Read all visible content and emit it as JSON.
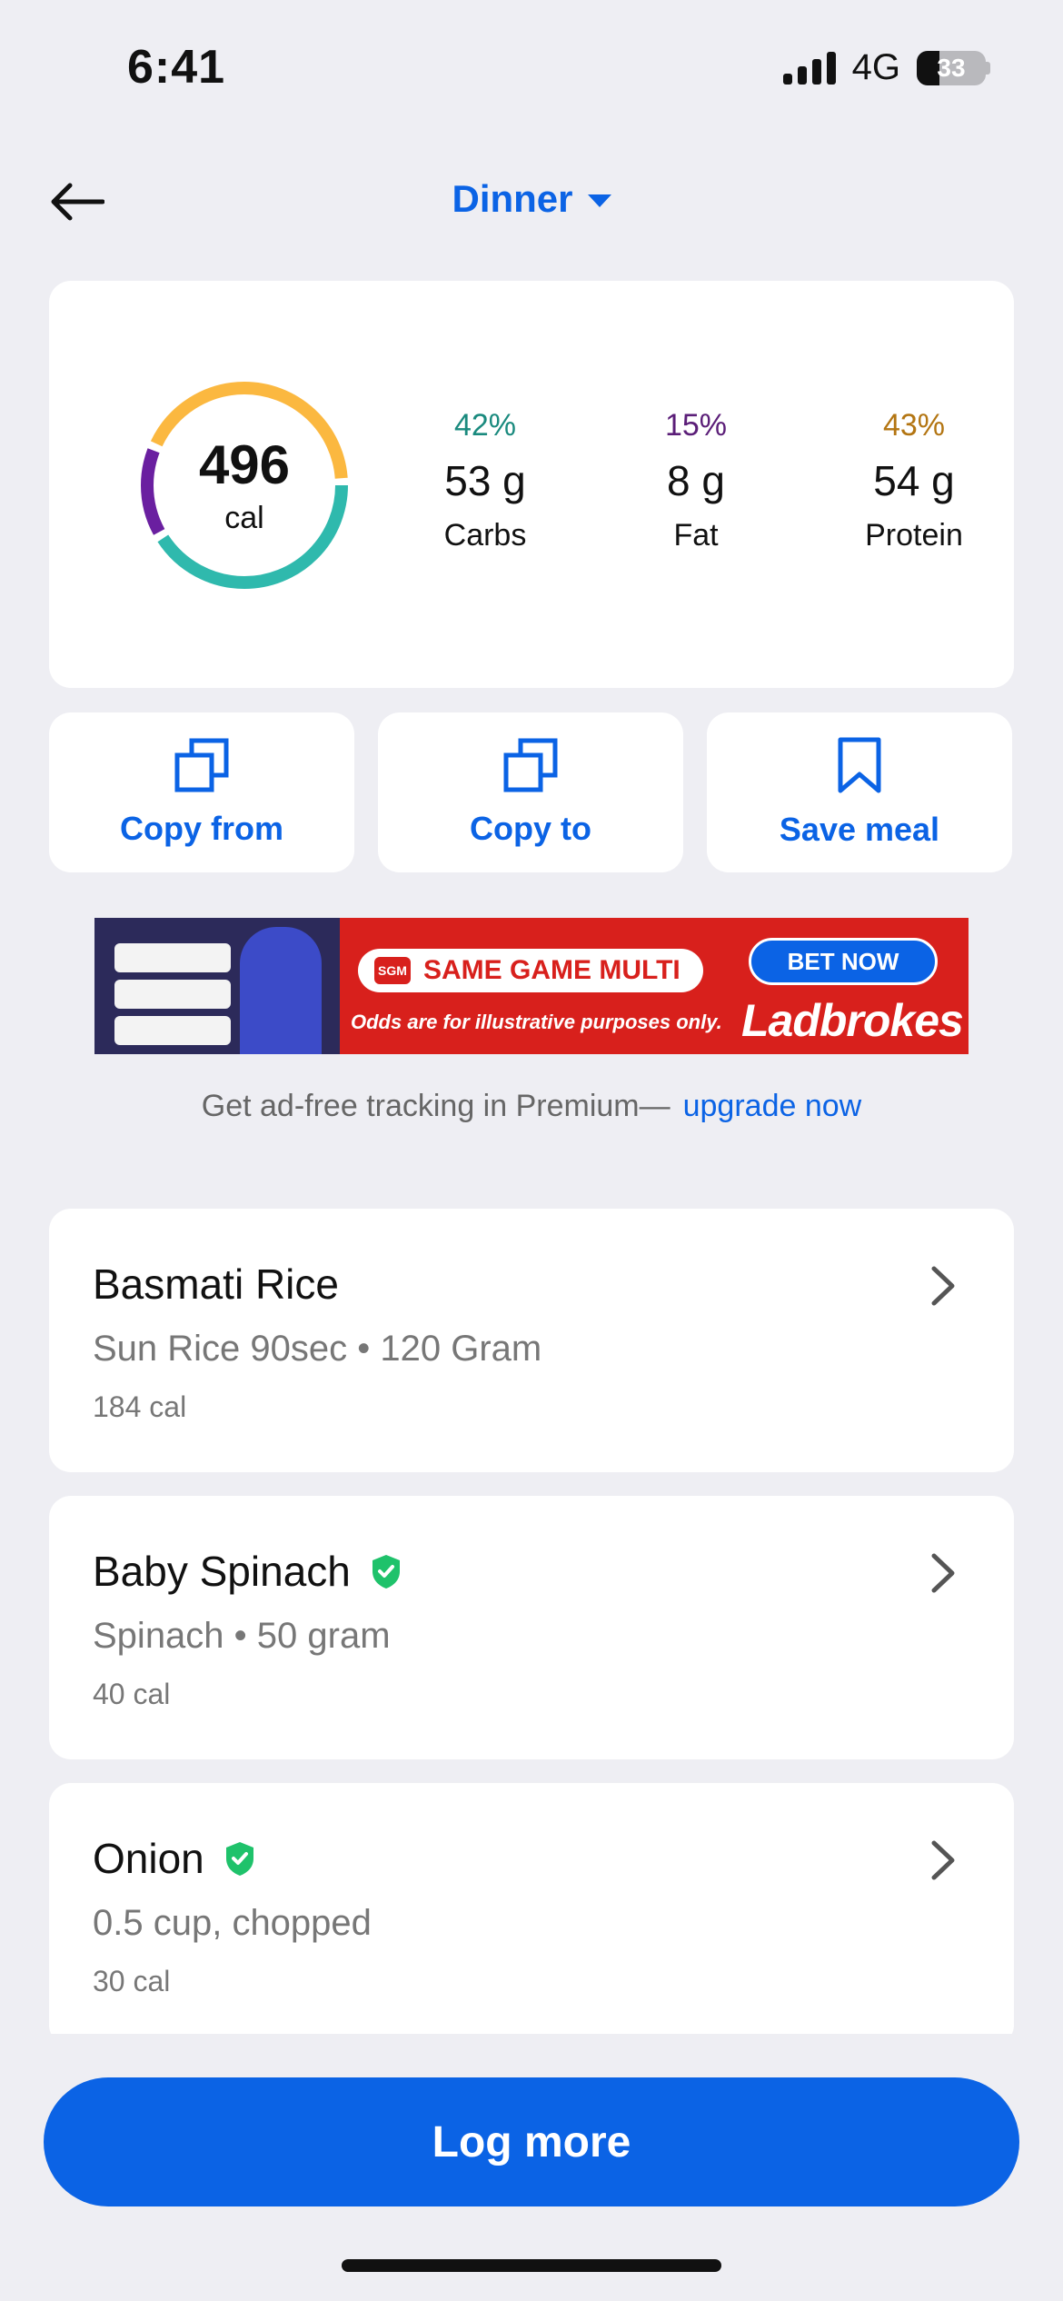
{
  "status": {
    "time": "6:41",
    "network": "4G",
    "battery": "33"
  },
  "header": {
    "meal": "Dinner"
  },
  "summary": {
    "calories": "496",
    "calories_unit": "cal",
    "macros": [
      {
        "pct": "42%",
        "amount": "53 g",
        "name": "Carbs",
        "color": "#1a8a7e"
      },
      {
        "pct": "15%",
        "amount": "8 g",
        "name": "Fat",
        "color": "#5b1e78"
      },
      {
        "pct": "43%",
        "amount": "54 g",
        "name": "Protein",
        "color": "#b37512"
      }
    ],
    "ring_colors": {
      "carbs": "#2fb9ad",
      "fat": "#6a1fa0",
      "protein": "#fbb840"
    }
  },
  "actions": {
    "copy_from": "Copy from",
    "copy_to": "Copy to",
    "save_meal": "Save meal"
  },
  "ad": {
    "headline": "SAME GAME MULTI",
    "logo_text": "SGM",
    "disclaimer": "Odds are for illustrative purposes only.",
    "cta": "BET NOW",
    "brand": "Ladbrokes"
  },
  "premium": {
    "text": "Get ad-free tracking in Premium—",
    "link": "upgrade now"
  },
  "foods": [
    {
      "name": "Basmati Rice",
      "detail": "Sun Rice 90sec • 120 Gram",
      "calories": "184 cal",
      "verified": false
    },
    {
      "name": "Baby Spinach",
      "detail": "Spinach • 50 gram",
      "calories": "40 cal",
      "verified": true
    },
    {
      "name": "Onion",
      "detail": "0.5 cup, chopped",
      "calories": "30 cal",
      "verified": true
    }
  ],
  "log_button": "Log more"
}
